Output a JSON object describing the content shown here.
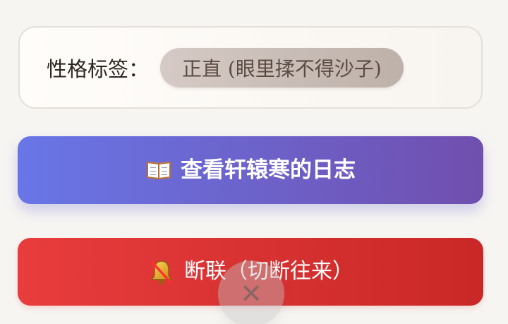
{
  "profile": {
    "tag_label": "性格标签：",
    "tag_value": "正直 (眼里揉不得沙子)"
  },
  "actions": {
    "diary_button": "查看轩辕寒的日志",
    "disconnect_button": "断联（切断往来）"
  },
  "overlay": {
    "close_button": "✕"
  },
  "icons": {
    "diary": "open-book-icon",
    "disconnect": "muted-bell-icon"
  },
  "colors": {
    "diary_gradient_start": "#6976e7",
    "diary_gradient_end": "#704fae",
    "disconnect_gradient_start": "#e83c3d",
    "disconnect_gradient_end": "#c92827",
    "tag_chip": "#c8bbb4"
  }
}
